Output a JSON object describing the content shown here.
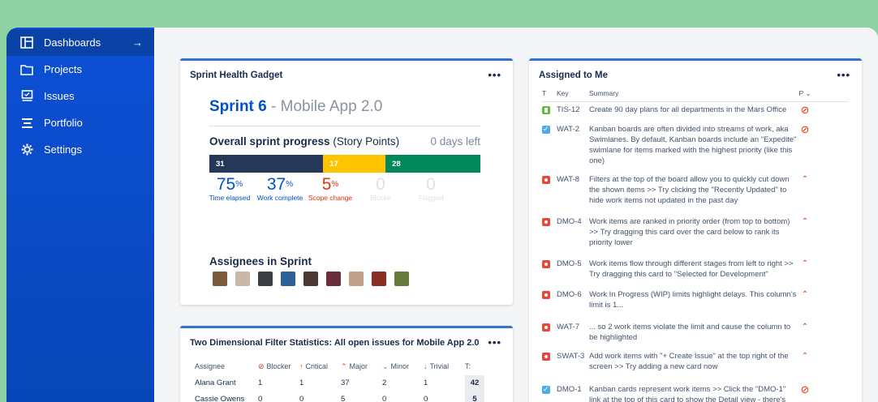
{
  "sidebar": {
    "items": [
      {
        "label": "Dashboards",
        "icon": "dashboard-icon",
        "active": true,
        "arrow": "→"
      },
      {
        "label": "Projects",
        "icon": "folder-icon"
      },
      {
        "label": "Issues",
        "icon": "issues-icon"
      },
      {
        "label": "Portfolio",
        "icon": "portfolio-icon"
      },
      {
        "label": "Settings",
        "icon": "gear-icon"
      }
    ]
  },
  "sprint_health": {
    "title": "Sprint Health Gadget",
    "more": "•••",
    "sprint_number": "Sprint 6",
    "sprint_separator": " - ",
    "sprint_project": "Mobile App 2.0",
    "progress_label": "Overall sprint progress",
    "progress_unit": "(Story Points)",
    "days_left": "0 days left",
    "bar": [
      {
        "value": "31",
        "color": "#253858",
        "fraction": 0.42
      },
      {
        "value": "17",
        "color": "#ffc400",
        "fraction": 0.23
      },
      {
        "value": "28",
        "color": "#00875a",
        "fraction": 0.35
      }
    ],
    "stats": [
      {
        "value": "75",
        "suffix": "%",
        "label": "Time elapsed",
        "color": "#0052cc"
      },
      {
        "value": "37",
        "suffix": "%",
        "label": "Work complete",
        "color": "#0052cc"
      },
      {
        "value": "5",
        "suffix": "%",
        "label": "Scope change",
        "color": "#de350b"
      },
      {
        "value": "0",
        "suffix": "",
        "label": "Blocke",
        "color": "#dfe1e6"
      },
      {
        "value": "0",
        "suffix": "",
        "label": "Flagged",
        "color": "#dfe1e6"
      }
    ],
    "assignees_title": "Assignees in Sprint",
    "avatar_colors": [
      "#7a5b3a",
      "#c9b8a6",
      "#3d3f45",
      "#2d5f9a",
      "#4a3a36",
      "#6b2d3a",
      "#bfa18a",
      "#8a2e22",
      "#6a7a3a"
    ]
  },
  "filter_stats": {
    "title": "Two Dimensional Filter Statistics: All open issues for Mobile App 2.0",
    "more": "•••",
    "headers": [
      "Assignee",
      "Blocker",
      "Critical",
      "Major",
      "Minor",
      "Trivial",
      "T:"
    ],
    "rows": [
      [
        "Alana Grant",
        "1",
        "1",
        "37",
        "2",
        "1",
        "42"
      ],
      [
        "Cassie Owens",
        "0",
        "0",
        "5",
        "0",
        "0",
        "5"
      ]
    ]
  },
  "assigned": {
    "title": "Assigned to Me",
    "more": "•••",
    "headers": {
      "t": "T",
      "key": "Key",
      "summary": "Summary",
      "p": "P ⌄"
    },
    "rows": [
      {
        "type": "story",
        "key": "TIS-12",
        "summary": "Create 90 day plans for all departments in the Mars Office",
        "priority": "blocker"
      },
      {
        "type": "task",
        "key": "WAT-2",
        "summary": "Kanban boards are often divided into streams of work, aka Swimlanes. By default, Kanban boards include an \"Expedite\" swimlane for items marked with the highest priority (like this one)",
        "priority": "blocker"
      },
      {
        "type": "bug",
        "key": "WAT-8",
        "summary": "Filters at the top of the board allow you to quickly cut down the shown items >> Try clicking the \"Recently Updated\" to hide work items not updated in the past day",
        "priority": "critical"
      },
      {
        "type": "bug",
        "key": "DMO-4",
        "summary": "Work items are ranked in priority order (from top to bottom) >> Try dragging this card over the card below to rank its priority lower",
        "priority": "critical"
      },
      {
        "type": "bug",
        "key": "DMO-5",
        "summary": "Work items flow through different stages from left to right >> Try dragging this card to \"Selected for Development\"",
        "priority": "critical"
      },
      {
        "type": "bug",
        "key": "DMO-6",
        "summary": "Work In Progress (WIP) limits highlight delays. This column's limit is 1...",
        "priority": "critical"
      },
      {
        "type": "bug",
        "key": "WAT-7",
        "summary": "... so 2 work items violate the limit and cause the column to be highlighted",
        "priority": "critical"
      },
      {
        "type": "bug",
        "key": "SWAT-3",
        "summary": "Add work items with \"+ Create Issue\" at the top right of the screen >> Try adding a new card now",
        "priority": "critical"
      },
      {
        "type": "task",
        "key": "DMO-1",
        "summary": "Kanban cards represent work items >> Click the \"DMO-1\" link at the top of this card to show the Detail view - there's more",
        "priority": "blocker"
      }
    ]
  }
}
